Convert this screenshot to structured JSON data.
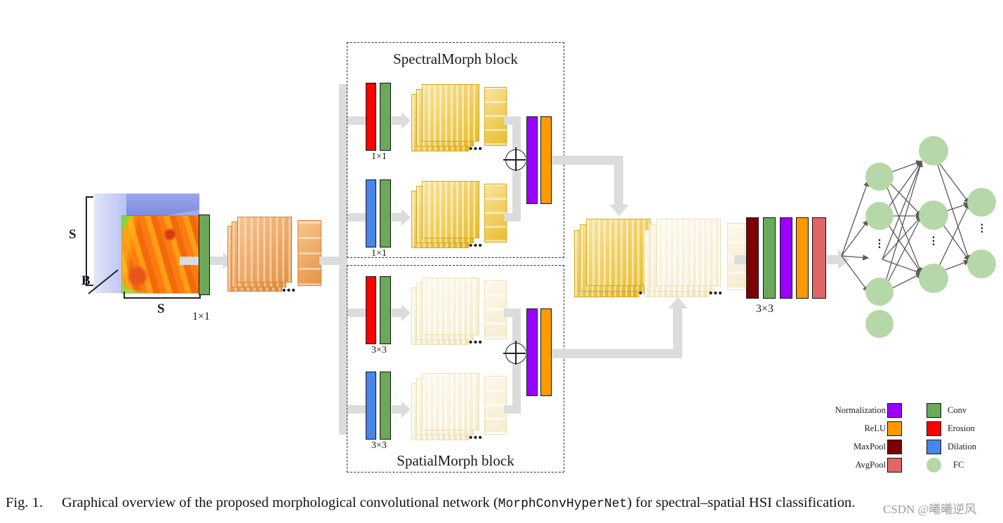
{
  "figure": {
    "caption_number": "Fig. 1.",
    "caption_pre": "Graphical overview of the proposed morphological convolutional network (",
    "caption_mono": "MorphConvHyperNet",
    "caption_post": ") for spectral–spatial HSI classification.",
    "watermark": "CSDN @曦曦逆风"
  },
  "input": {
    "dim_height_label": "S",
    "dim_depth_label": "B",
    "dim_width_label": "S",
    "cube_color": "#5b6fd6",
    "image_name": "hyperspectral-image-patch"
  },
  "stem": {
    "conv_label": "1×1",
    "conv_color": "#6aa85a",
    "feature_stack_color": "#e08e3c"
  },
  "spectral_block": {
    "title": "SpectralMorph block",
    "branches": [
      {
        "op": "Erosion",
        "op_color": "#ff0000",
        "conv_color": "#6aa85a",
        "kernel_label": "1×1"
      },
      {
        "op": "Dilation",
        "op_color": "#4a86e8",
        "conv_color": "#6aa85a",
        "kernel_label": "1×1"
      }
    ],
    "merge_symbol": "⊕",
    "post_ops": [
      {
        "name": "Normalization",
        "color": "#9900ff"
      },
      {
        "name": "ReLU",
        "color": "#ff9900"
      }
    ],
    "feature_stack_color": "#e8b923",
    "ellipsis": "•••"
  },
  "spatial_block": {
    "title": "SpatialMorph block",
    "branches": [
      {
        "op": "Erosion",
        "op_color": "#ff0000",
        "conv_color": "#6aa85a",
        "kernel_label": "3×3"
      },
      {
        "op": "Dilation",
        "op_color": "#4a86e8",
        "conv_color": "#6aa85a",
        "kernel_label": "3×3"
      }
    ],
    "merge_symbol": "⊕",
    "post_ops": [
      {
        "name": "Normalization",
        "color": "#9900ff"
      },
      {
        "name": "ReLU",
        "color": "#ff9900"
      }
    ],
    "feature_stack_color": "#f6edc9",
    "ellipsis": "•••"
  },
  "fusion": {
    "spectral_stack_color": "#e8b923",
    "spatial_stack_color": "#f6edc9",
    "ellipsis_left": "•••",
    "ellipsis_right": "•••"
  },
  "head": {
    "kernel_label": "3×3",
    "bars": [
      {
        "name": "MaxPool",
        "color": "#7d0000"
      },
      {
        "name": "Conv",
        "color": "#6aa85a"
      },
      {
        "name": "Normalization",
        "color": "#9900ff"
      },
      {
        "name": "ReLU",
        "color": "#ff9900"
      },
      {
        "name": "AvgPool",
        "color": "#e06666"
      }
    ]
  },
  "fc_network": {
    "node_color": "#b6d7a8",
    "layers": [
      4,
      3,
      2
    ],
    "vertical_ellipsis": "⋮"
  },
  "legend": {
    "left_column": [
      {
        "label": "Normalization",
        "color": "#9900ff"
      },
      {
        "label": "ReLU",
        "color": "#ff9900"
      },
      {
        "label": "MaxPool",
        "color": "#7d0000"
      },
      {
        "label": "AvgPool",
        "color": "#e06666"
      }
    ],
    "right_column": [
      {
        "label": "Conv",
        "color": "#6aa85a",
        "shape": "square"
      },
      {
        "label": "Erosion",
        "color": "#ff0000",
        "shape": "square"
      },
      {
        "label": "Dilation",
        "color": "#4a86e8",
        "shape": "square"
      },
      {
        "label": "FC",
        "color": "#b6d7a8",
        "shape": "circle"
      }
    ]
  }
}
